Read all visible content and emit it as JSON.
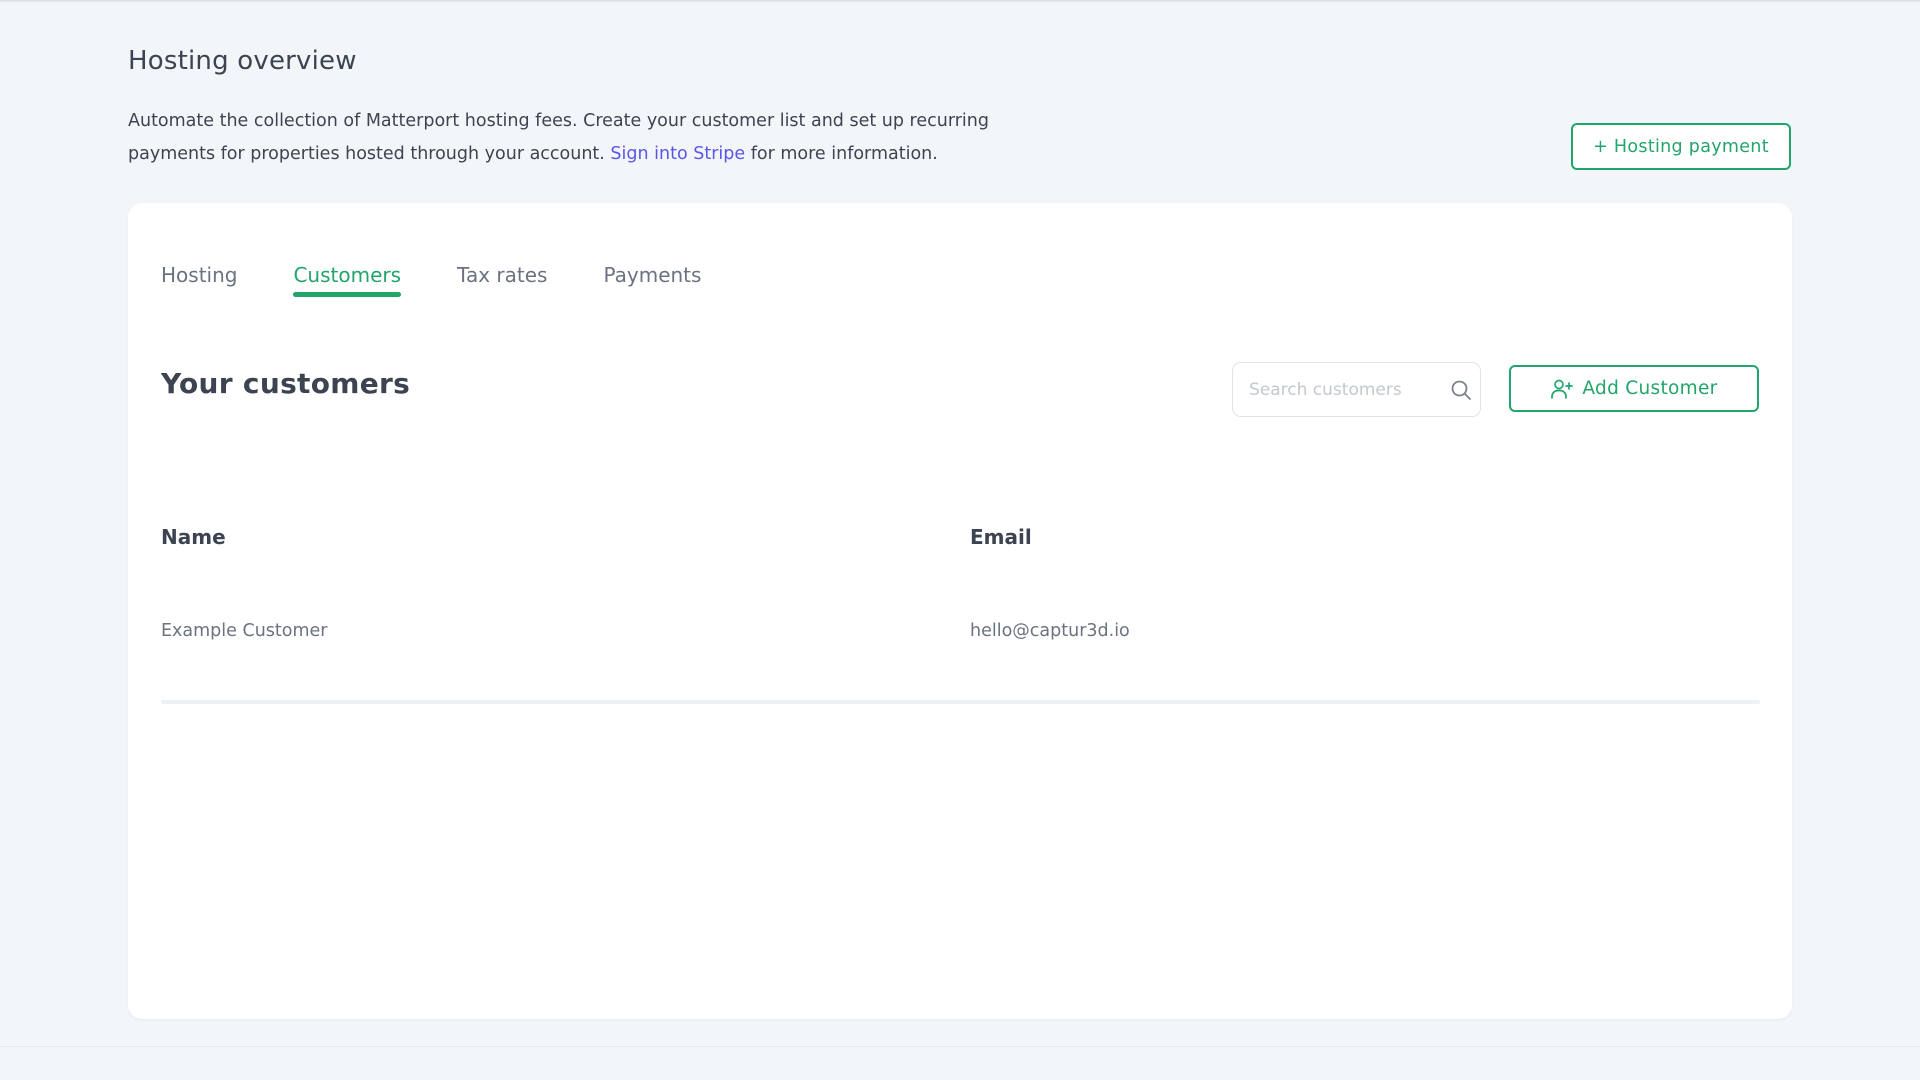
{
  "header": {
    "title": "Hosting overview",
    "intro_before_link": "Automate the collection of Matterport hosting fees. Create your customer list and set up recurring payments for properties hosted through your account. ",
    "intro_link": "Sign into Stripe",
    "intro_after_link": " for more information.",
    "hosting_payment_label": "+ Hosting payment"
  },
  "tabs": [
    {
      "label": "Hosting",
      "active": false
    },
    {
      "label": "Customers",
      "active": true
    },
    {
      "label": "Tax rates",
      "active": false
    },
    {
      "label": "Payments",
      "active": false
    }
  ],
  "customers": {
    "title": "Your customers",
    "search_placeholder": "Search customers",
    "search_value": "",
    "add_label": "Add Customer",
    "columns": {
      "name": "Name",
      "email": "Email"
    },
    "rows": [
      {
        "name": "Example Customer",
        "email": "hello@captur3d.io"
      }
    ]
  },
  "colors": {
    "accent": "#21a56a",
    "link": "#5b55e8",
    "background": "#f3f6f9"
  },
  "icons": {
    "search": "search-icon",
    "add_user": "user-plus-icon"
  }
}
